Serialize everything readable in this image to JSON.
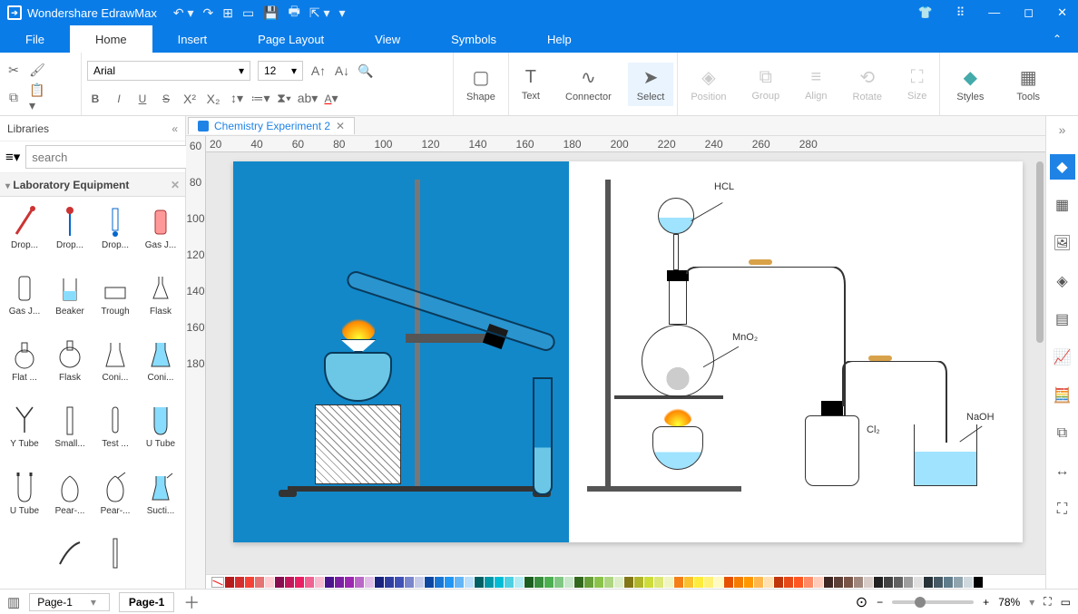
{
  "app": {
    "name": "Wondershare EdrawMax"
  },
  "menu": {
    "tabs": [
      "File",
      "Home",
      "Insert",
      "Page Layout",
      "View",
      "Symbols",
      "Help"
    ],
    "activeIndex": 1
  },
  "ribbon": {
    "font": "Arial",
    "size": "12",
    "groups": {
      "shape": "Shape",
      "text": "Text",
      "connector": "Connector",
      "select": "Select",
      "position": "Position",
      "group": "Group",
      "align": "Align",
      "rotate": "Rotate",
      "size": "Size",
      "styles": "Styles",
      "tools": "Tools"
    }
  },
  "sidebar": {
    "title": "Libraries",
    "search_placeholder": "search",
    "libName": "Laboratory Equipment",
    "shapes": [
      "Drop...",
      "Drop...",
      "Drop...",
      "Gas J...",
      "Gas J...",
      "Beaker",
      "Trough",
      "Flask",
      "Flat ...",
      "Flask",
      "Coni...",
      "Coni...",
      "Y Tube",
      "Small...",
      "Test ...",
      "U Tube",
      "U Tube",
      "Pear-...",
      "Pear-...",
      "Sucti...",
      "",
      "",
      "",
      ""
    ]
  },
  "document": {
    "tabName": "Chemistry Experiment 2"
  },
  "ruler": {
    "h": [
      "20",
      "40",
      "60",
      "80",
      "100",
      "120",
      "140",
      "160",
      "180",
      "200",
      "220",
      "240",
      "260",
      "280"
    ],
    "v": [
      "60",
      "80",
      "100",
      "120",
      "140",
      "160",
      "180"
    ]
  },
  "diagramLabels": {
    "hcl": "HCL",
    "mno2": "MnO₂",
    "cl2": "Cl₂",
    "naoh": "NaOH"
  },
  "status": {
    "pageDrop": "Page-1",
    "pageTab": "Page-1",
    "zoom": "78%"
  },
  "colors": [
    "#b71c1c",
    "#d32f2f",
    "#f44336",
    "#e57373",
    "#ffcdd2",
    "#880e4f",
    "#c2185b",
    "#e91e63",
    "#f06292",
    "#f8bbd0",
    "#4a148c",
    "#7b1fa2",
    "#9c27b0",
    "#ba68c8",
    "#e1bee7",
    "#1a237e",
    "#303f9f",
    "#3f51b5",
    "#7986cb",
    "#c5cae9",
    "#0d47a1",
    "#1976d2",
    "#2196f3",
    "#64b5f6",
    "#bbdefb",
    "#006064",
    "#0097a7",
    "#00bcd4",
    "#4dd0e1",
    "#b2ebf2",
    "#1b5e20",
    "#388e3c",
    "#4caf50",
    "#81c784",
    "#c8e6c9",
    "#33691e",
    "#689f38",
    "#8bc34a",
    "#aed581",
    "#dcedc8",
    "#827717",
    "#afb42b",
    "#cddc39",
    "#dce775",
    "#f0f4c3",
    "#f57f17",
    "#fbc02d",
    "#ffeb3b",
    "#fff176",
    "#fff9c4",
    "#e65100",
    "#f57c00",
    "#ff9800",
    "#ffb74d",
    "#ffe0b2",
    "#bf360c",
    "#e64a19",
    "#ff5722",
    "#ff8a65",
    "#ffccbc",
    "#3e2723",
    "#5d4037",
    "#795548",
    "#a1887f",
    "#d7ccc8",
    "#212121",
    "#424242",
    "#616161",
    "#9e9e9e",
    "#e0e0e0",
    "#263238",
    "#455a64",
    "#607d8b",
    "#90a4ae",
    "#cfd8dc",
    "#000000",
    "#ffffff"
  ]
}
